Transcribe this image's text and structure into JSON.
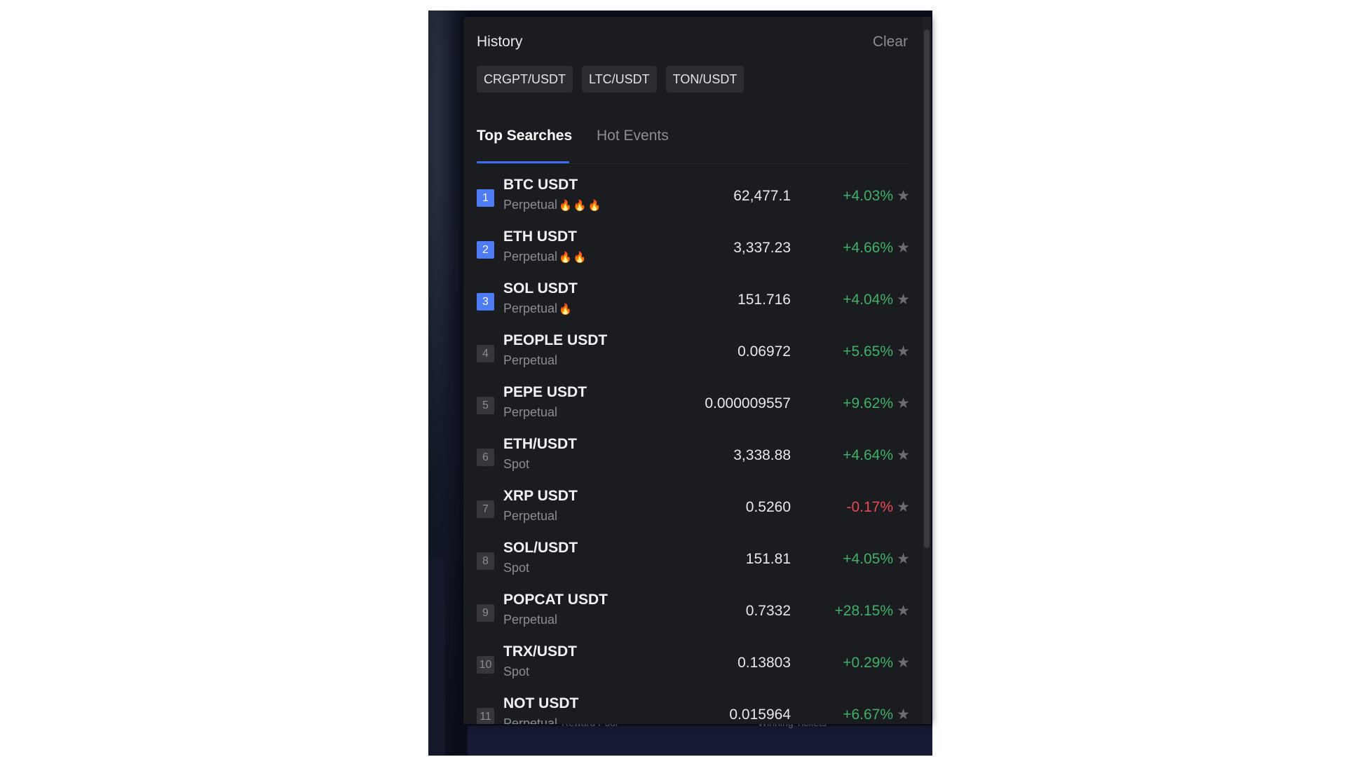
{
  "history": {
    "title": "History",
    "clear_label": "Clear",
    "chips": [
      "CRGPT/USDT",
      "LTC/USDT",
      "TON/USDT"
    ]
  },
  "tabs": [
    {
      "label": "Top Searches",
      "active": true
    },
    {
      "label": "Hot Events",
      "active": false
    }
  ],
  "background": {
    "footer_left": "Reward Pool",
    "footer_right": "Winning Tickets"
  },
  "colors": {
    "accent": "#3b6ef5",
    "up": "#3fb068",
    "down": "#e84a55",
    "panel": "#1b1c1f"
  },
  "rows": [
    {
      "rank": "1",
      "symbol": "BTC USDT",
      "type": "Perpetual",
      "hot": 3,
      "price": "62,477.1",
      "change": "+4.03%",
      "trend": "up"
    },
    {
      "rank": "2",
      "symbol": "ETH USDT",
      "type": "Perpetual",
      "hot": 2,
      "price": "3,337.23",
      "change": "+4.66%",
      "trend": "up"
    },
    {
      "rank": "3",
      "symbol": "SOL USDT",
      "type": "Perpetual",
      "hot": 1,
      "price": "151.716",
      "change": "+4.04%",
      "trend": "up"
    },
    {
      "rank": "4",
      "symbol": "PEOPLE USDT",
      "type": "Perpetual",
      "hot": 0,
      "price": "0.06972",
      "change": "+5.65%",
      "trend": "up"
    },
    {
      "rank": "5",
      "symbol": "PEPE USDT",
      "type": "Perpetual",
      "hot": 0,
      "price": "0.000009557",
      "change": "+9.62%",
      "trend": "up"
    },
    {
      "rank": "6",
      "symbol": "ETH/USDT",
      "type": "Spot",
      "hot": 0,
      "price": "3,338.88",
      "change": "+4.64%",
      "trend": "up"
    },
    {
      "rank": "7",
      "symbol": "XRP USDT",
      "type": "Perpetual",
      "hot": 0,
      "price": "0.5260",
      "change": "-0.17%",
      "trend": "down"
    },
    {
      "rank": "8",
      "symbol": "SOL/USDT",
      "type": "Spot",
      "hot": 0,
      "price": "151.81",
      "change": "+4.05%",
      "trend": "up"
    },
    {
      "rank": "9",
      "symbol": "POPCAT USDT",
      "type": "Perpetual",
      "hot": 0,
      "price": "0.7332",
      "change": "+28.15%",
      "trend": "up"
    },
    {
      "rank": "10",
      "symbol": "TRX/USDT",
      "type": "Spot",
      "hot": 0,
      "price": "0.13803",
      "change": "+0.29%",
      "trend": "up"
    },
    {
      "rank": "11",
      "symbol": "NOT USDT",
      "type": "Perpetual",
      "hot": 0,
      "price": "0.015964",
      "change": "+6.67%",
      "trend": "up"
    }
  ]
}
